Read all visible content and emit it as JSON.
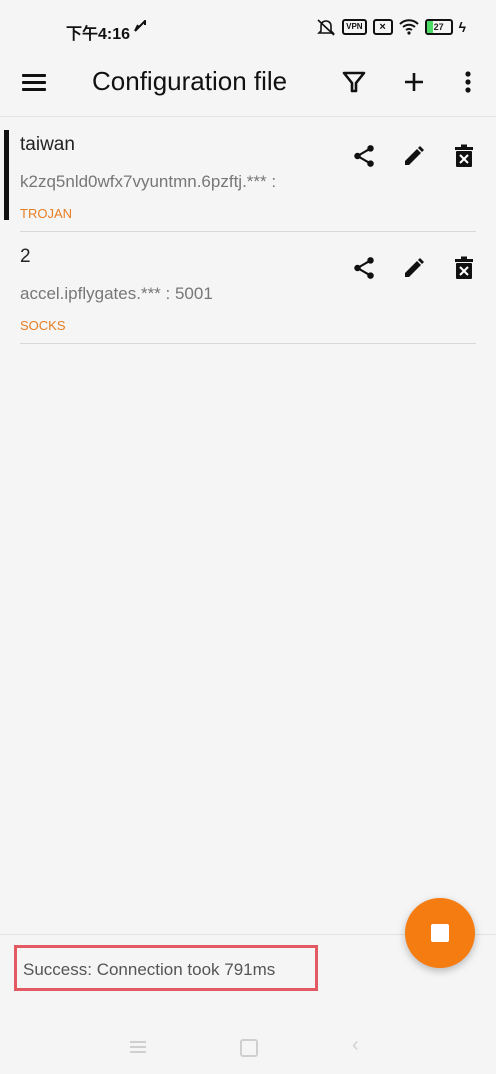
{
  "status_bar": {
    "time": "下午4:16",
    "notification_icon": "check-flag",
    "icons": [
      "mute-bell-icon",
      "vpn-icon",
      "no-sim-icon",
      "wifi-icon",
      "battery-icon",
      "charging-icon"
    ],
    "vpn_label": "VPN",
    "battery_level": "27"
  },
  "toolbar": {
    "title": "Configuration file",
    "icons": [
      "menu-icon",
      "filter-icon",
      "add-icon",
      "more-icon"
    ]
  },
  "profiles": [
    {
      "name": "taiwan",
      "address": "k2zq5nld0wfx7vyuntmn.6pzftj.*** :",
      "type": "TROJAN",
      "selected": true
    },
    {
      "name": "2",
      "address": "accel.ipflygates.*** : 5001",
      "type": "SOCKS",
      "selected": false
    }
  ],
  "status": {
    "message": "Success: Connection took 791ms"
  },
  "fab": {
    "icon": "stop-icon",
    "color": "#f57c10"
  },
  "colors": {
    "accent": "#f57c10",
    "type_label": "#e67e22",
    "highlight_border": "#e45a62"
  },
  "nav": {
    "icons": [
      "recent-apps-icon",
      "home-icon",
      "back-icon"
    ]
  }
}
